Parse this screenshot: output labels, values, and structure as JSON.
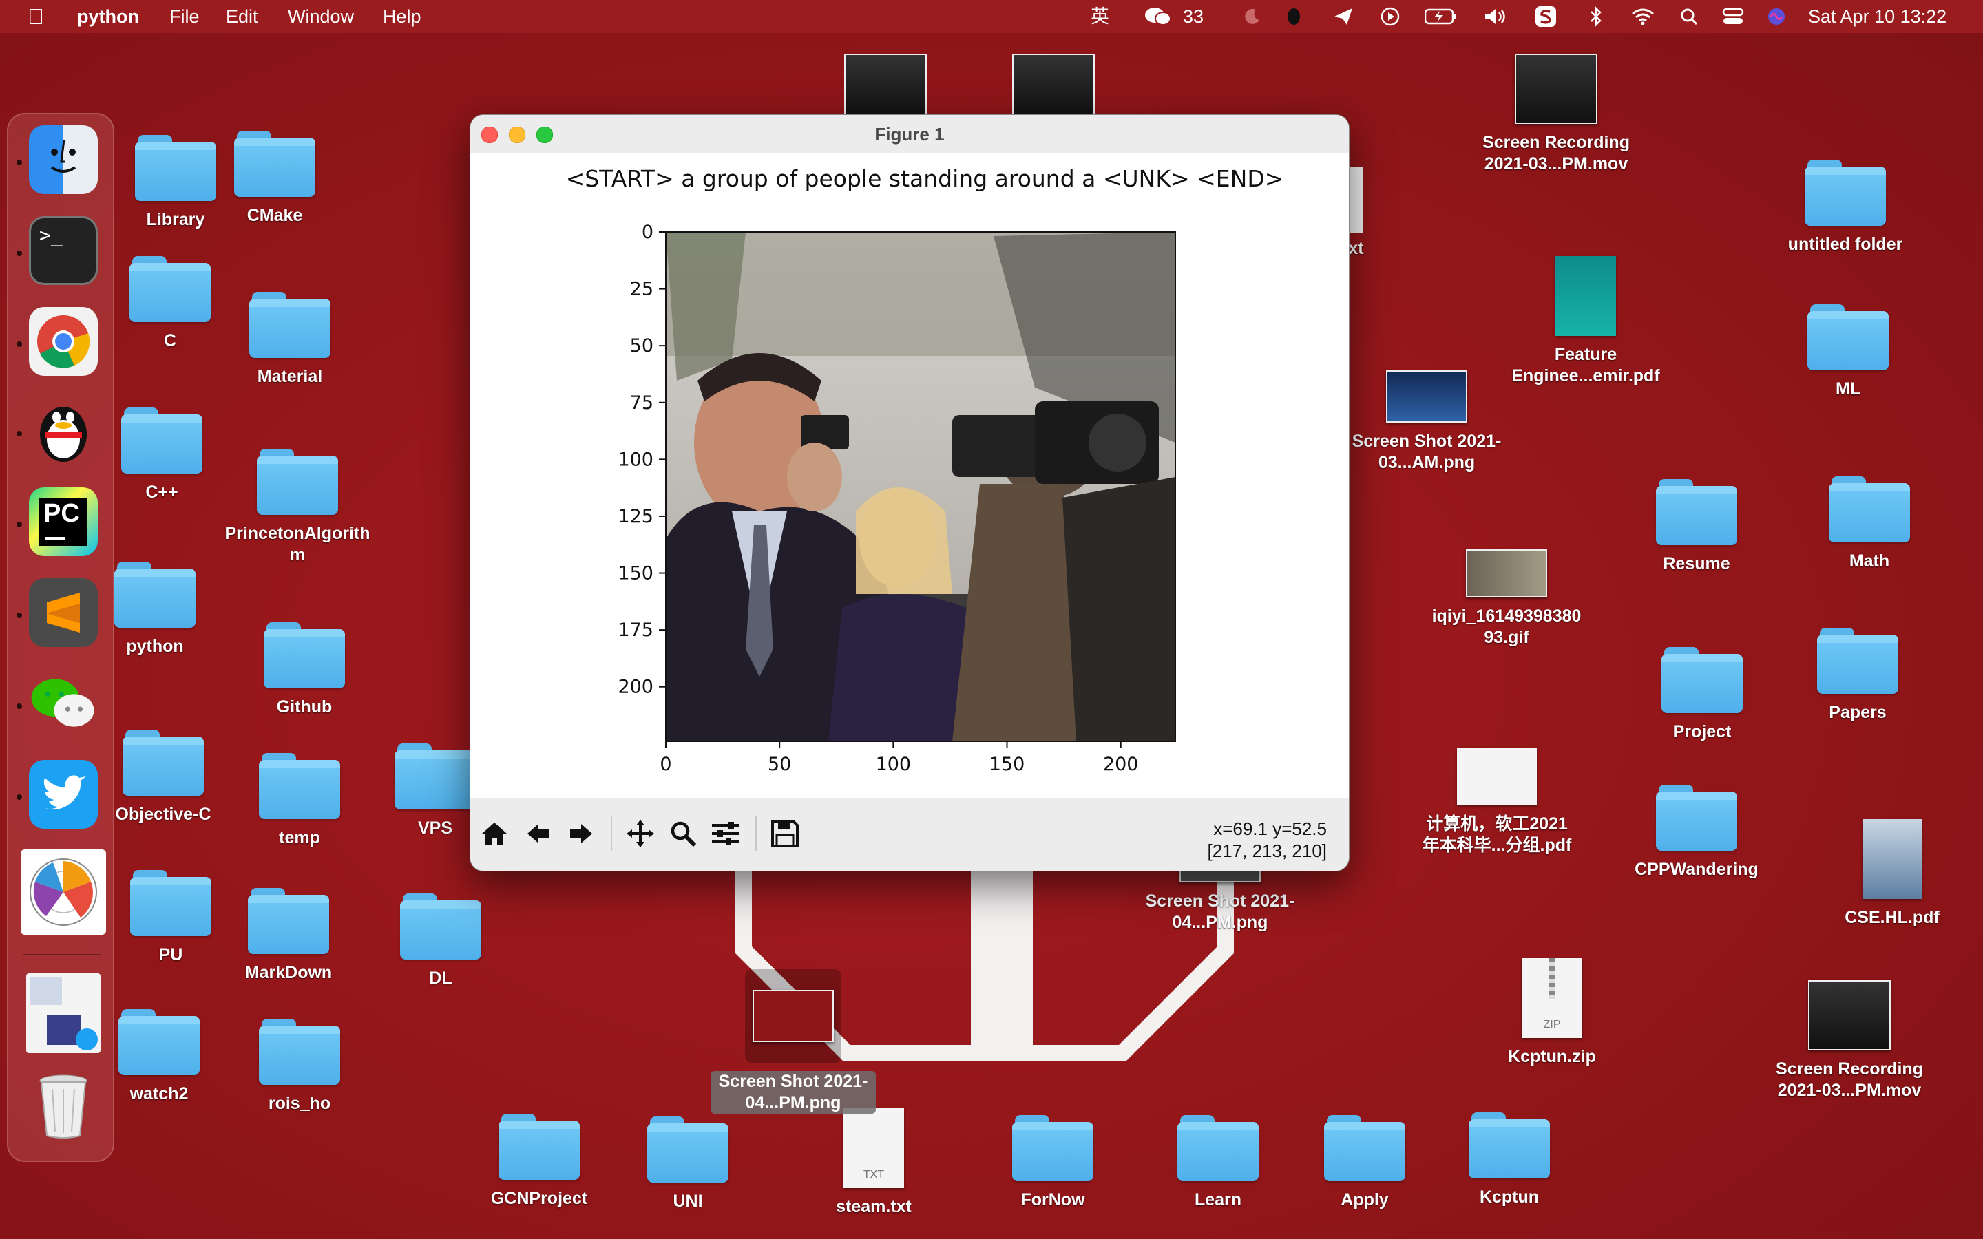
{
  "menubar": {
    "app_name": "python",
    "menus": [
      "File",
      "Edit",
      "Window",
      "Help"
    ],
    "input_method": "英",
    "wechat_count": "33",
    "datetime": "Sat Apr 10  13:22"
  },
  "dock": {
    "apps": [
      "Finder",
      "Terminal",
      "Google Chrome",
      "QQ",
      "PyCharm",
      "Sublime Text",
      "WeChat",
      "Twitter",
      "Radar Chart App",
      "Screenshot Preview",
      "Trash"
    ]
  },
  "desktop_icons": [
    {
      "label": "Library",
      "kind": "folder"
    },
    {
      "label": "CMake",
      "kind": "folder"
    },
    {
      "label": "C",
      "kind": "folder"
    },
    {
      "label": "Material",
      "kind": "folder"
    },
    {
      "label": "C++",
      "kind": "folder"
    },
    {
      "label": "PrincetonAlgorithm",
      "kind": "folder"
    },
    {
      "label": "python",
      "kind": "folder"
    },
    {
      "label": "Github",
      "kind": "folder"
    },
    {
      "label": "Objective-C",
      "kind": "folder"
    },
    {
      "label": "temp",
      "kind": "folder"
    },
    {
      "label": "VPS",
      "kind": "folder"
    },
    {
      "label": "PU",
      "kind": "folder"
    },
    {
      "label": "MarkDown",
      "kind": "folder"
    },
    {
      "label": "DL",
      "kind": "folder"
    },
    {
      "label": "watch2",
      "kind": "folder"
    },
    {
      "label": "rois_ho",
      "kind": "folder"
    },
    {
      "label": "GCNProject",
      "kind": "folder"
    },
    {
      "label": "UNI",
      "kind": "folder"
    },
    {
      "label": "steam.txt",
      "kind": "txt"
    },
    {
      "label": "ForNow",
      "kind": "folder"
    },
    {
      "label": "Learn",
      "kind": "folder"
    },
    {
      "label": "Apply",
      "kind": "folder"
    },
    {
      "label": "Kcptun",
      "kind": "folder"
    },
    {
      "label": "Screen Recording 2021-03...PM.mov",
      "kind": "video"
    },
    {
      "label": "untitled folder",
      "kind": "folder"
    },
    {
      "label": "Feature Enginee...emir.pdf",
      "kind": "pdf"
    },
    {
      "label": "ML",
      "kind": "folder"
    },
    {
      "label": "Screen Shot 2021-03...AM.png",
      "kind": "image"
    },
    {
      "label": "Resume",
      "kind": "folder"
    },
    {
      "label": "Math",
      "kind": "folder"
    },
    {
      "label": "iqiyi_1614939838093.gif",
      "kind": "image"
    },
    {
      "label": "Project",
      "kind": "folder"
    },
    {
      "label": "Papers",
      "kind": "folder"
    },
    {
      "label": "计算机，软工2021年本科毕...分组.pdf",
      "kind": "pdf"
    },
    {
      "label": "CPPWandering",
      "kind": "folder"
    },
    {
      "label": "CSE.HL.pdf",
      "kind": "pdf"
    },
    {
      "label": "Screen Shot 2021-04...PM.png",
      "kind": "image"
    },
    {
      "label": "Kcptun.zip",
      "kind": "zip"
    },
    {
      "label": "Screen Recording 2021-03...PM.mov",
      "kind": "video"
    },
    {
      "label": "Screen Shot 2021-04...PM.png",
      "kind": "image"
    },
    {
      "label": "txt",
      "kind": "txt"
    }
  ],
  "desktop_icon_misc": {
    "txt_badge": "TXT",
    "zip_badge": "ZIP"
  },
  "figure_window": {
    "title": "Figure 1",
    "caption": "<START> a group of people standing around a <UNK> <END>",
    "status_xy": "x=69.1 y=52.5",
    "status_rgb": "[217, 213, 210]",
    "toolbar": [
      "home-icon",
      "back-arrow-icon",
      "forward-arrow-icon",
      "pan-icon",
      "zoom-icon",
      "configure-subplots-icon",
      "save-icon"
    ]
  },
  "chart_data": {
    "type": "image",
    "title": "<START> a group of people standing around a <UNK> <END>",
    "xlabel": "",
    "ylabel": "",
    "xlim": [
      0,
      224
    ],
    "ylim": [
      224,
      0
    ],
    "xticks": [
      0,
      50,
      100,
      150,
      200
    ],
    "yticks": [
      0,
      25,
      50,
      75,
      100,
      125,
      150,
      175,
      200
    ],
    "image_description_hidden": true
  }
}
